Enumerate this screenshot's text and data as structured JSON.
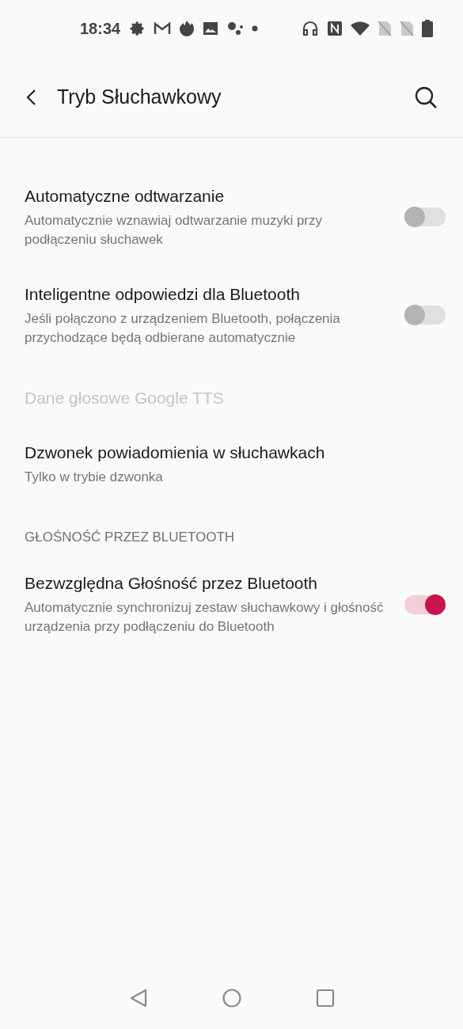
{
  "status_bar": {
    "time": "18:34"
  },
  "header": {
    "title": "Tryb Słuchawkowy"
  },
  "items": [
    {
      "kind": "toggle",
      "title": "Automatyczne odtwarzanie",
      "subtitle": "Automatycznie wznawiaj odtwarzanie muzyki przy podłączeniu słuchawek",
      "on": false
    },
    {
      "kind": "toggle",
      "title": "Inteligentne odpowiedzi dla Bluetooth",
      "subtitle": "Jeśli połączono z urządzeniem Bluetooth, połączenia przychodzące będą odbierane automatycznie",
      "on": false
    },
    {
      "kind": "plain",
      "title": "Dane głosowe Google TTS",
      "disabled": true
    },
    {
      "kind": "plain",
      "title": "Dzwonek powiadomienia w słuchawkach",
      "subtitle": "Tylko w trybie dzwonka",
      "disabled": false
    },
    {
      "kind": "heading",
      "title": "GŁOŚNOŚĆ PRZEZ BLUETOOTH"
    },
    {
      "kind": "toggle",
      "title": "Bezwzględna Głośność przez Bluetooth",
      "subtitle": "Automatycznie synchronizuj zestaw słuchawkowy i głośność urządzenia przy podłączeniu do Bluetooth",
      "on": true
    }
  ]
}
